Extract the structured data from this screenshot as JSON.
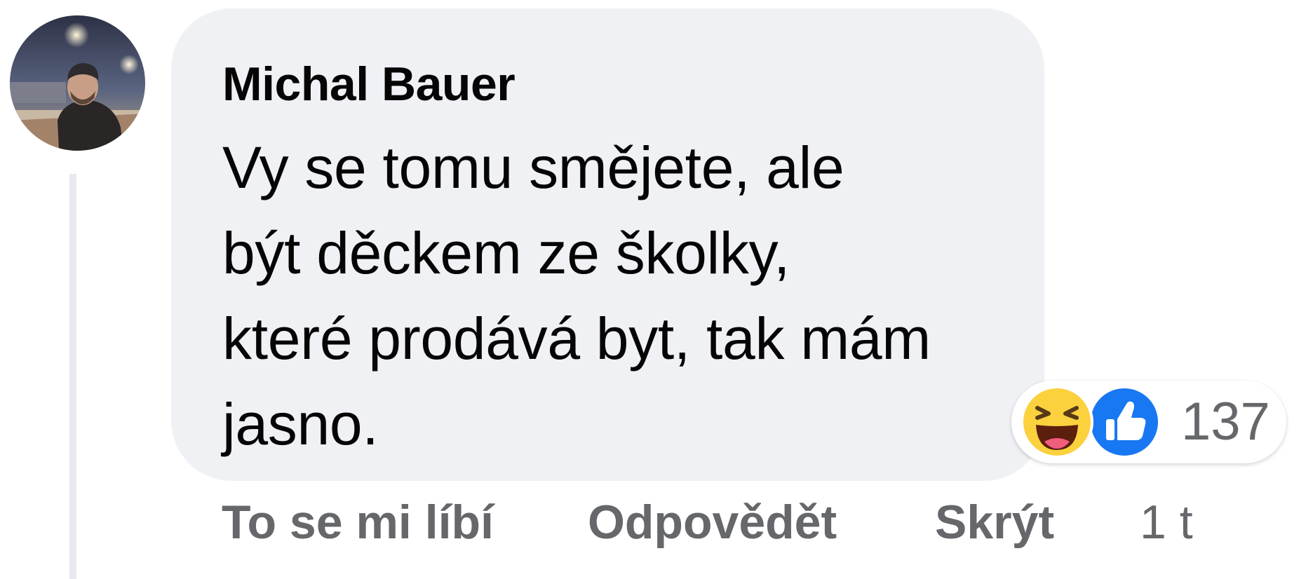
{
  "comment": {
    "author": "Michal Bauer",
    "text": "Vy se tomu smějete, ale být děckem ze školky, které prodává byt, tak mám jasno.",
    "timestamp": "1 t"
  },
  "reactions": {
    "icons": [
      "haha-emoji",
      "like-thumb"
    ],
    "count": "137"
  },
  "actions": {
    "like_label": "To se mi líbí",
    "reply_label": "Odpovědět",
    "hide_label": "Skrýt"
  },
  "colors": {
    "bubble_bg": "#f0f1f5",
    "secondary_text": "#65676b",
    "like_blue": "#1877f2",
    "haha_yellow": "#fcd13e"
  }
}
